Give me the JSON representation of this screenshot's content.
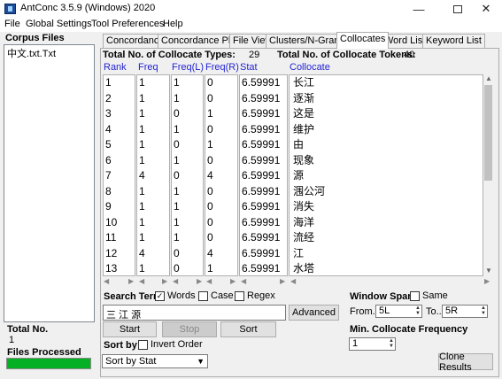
{
  "window": {
    "title": "AntConc 3.5.9 (Windows) 2020"
  },
  "menu": [
    "File",
    "Global Settings",
    "Tool Preferences",
    "Help"
  ],
  "corpus": {
    "title": "Corpus Files",
    "files": [
      "中文.txt.Txt"
    ],
    "total_label": "Total No.",
    "total_value": "1",
    "processed_label": "Files Processed",
    "progress": 1.0
  },
  "tabs": [
    "Concordance",
    "Concordance Plot",
    "File View",
    "Clusters/N-Grams",
    "Collocates",
    "Word List",
    "Keyword List"
  ],
  "active_tab": "Collocates",
  "summary": {
    "types_label": "Total No. of Collocate Types:",
    "types_value": "29",
    "tokens_label": "Total No. of Collocate Tokens:",
    "tokens_value": "40"
  },
  "columns": [
    "Rank",
    "Freq",
    "Freq(L)",
    "Freq(R)",
    "Stat",
    "Collocate"
  ],
  "rows": [
    [
      "1",
      "1",
      "1",
      "0",
      "6.59991",
      "长江"
    ],
    [
      "2",
      "1",
      "1",
      "0",
      "6.59991",
      "逐渐"
    ],
    [
      "3",
      "1",
      "0",
      "1",
      "6.59991",
      "这是"
    ],
    [
      "4",
      "1",
      "1",
      "0",
      "6.59991",
      "维护"
    ],
    [
      "5",
      "1",
      "0",
      "1",
      "6.59991",
      "由"
    ],
    [
      "6",
      "1",
      "1",
      "0",
      "6.59991",
      "现象"
    ],
    [
      "7",
      "4",
      "0",
      "4",
      "6.59991",
      "源"
    ],
    [
      "8",
      "1",
      "1",
      "0",
      "6.59991",
      "涠公河"
    ],
    [
      "9",
      "1",
      "1",
      "0",
      "6.59991",
      "消失"
    ],
    [
      "10",
      "1",
      "1",
      "0",
      "6.59991",
      "海洋"
    ],
    [
      "11",
      "1",
      "1",
      "0",
      "6.59991",
      "流经"
    ],
    [
      "12",
      "4",
      "0",
      "4",
      "6.59991",
      "江"
    ],
    [
      "13",
      "1",
      "0",
      "1",
      "6.59991",
      "水塔"
    ]
  ],
  "search": {
    "label": "Search Term",
    "words_label": "Words",
    "words_checked": true,
    "case_label": "Case",
    "case_checked": false,
    "regex_label": "Regex",
    "regex_checked": false,
    "value": "三 江 源",
    "advanced_label": "Advanced",
    "start_label": "Start",
    "stop_label": "Stop",
    "sort_label": "Sort"
  },
  "sort": {
    "label": "Sort by",
    "invert_label": "Invert Order",
    "invert_checked": false,
    "selected": "Sort by Stat"
  },
  "window_span": {
    "label": "Window Span",
    "same_label": "Same",
    "same_checked": false,
    "from_label": "From",
    "from_value": "5L",
    "to_label": "To",
    "to_value": "5R"
  },
  "min_freq": {
    "label": "Min. Collocate Frequency",
    "value": "1"
  },
  "clone_label": "Clone Results"
}
